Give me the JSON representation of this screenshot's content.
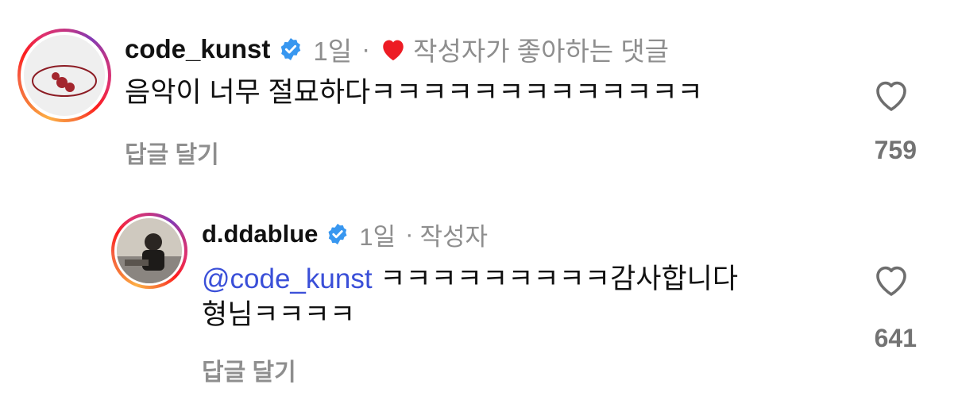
{
  "comments": [
    {
      "username": "code_kunst",
      "time": "1일",
      "separator": "·",
      "liked_by_author_label": "작성자가 좋아하는 댓글",
      "text": "음악이 너무 절묘하다ㅋㅋㅋㅋㅋㅋㅋㅋㅋㅋㅋㅋㅋ",
      "reply_label": "답글 달기",
      "like_count": "759"
    },
    {
      "username": "d.ddablue",
      "time": "1일",
      "separator": "·",
      "author_label": "작성자",
      "mention": "@code_kunst",
      "text_line1": " ㅋㅋㅋㅋㅋㅋㅋㅋㅋ감사합니다",
      "text_line2": "형님ㅋㅋㅋㅋ",
      "reply_label": "답글 달기",
      "like_count": "641"
    }
  ],
  "colors": {
    "verified_blue": "#3897f0",
    "liked_heart_red": "#ed1c24",
    "mention_blue": "#3a4fd8",
    "muted_gray": "#8e8e8e"
  },
  "icons": {
    "verified": "verified-badge-icon",
    "liked_heart": "heart-filled-icon",
    "like": "heart-outline-icon"
  }
}
